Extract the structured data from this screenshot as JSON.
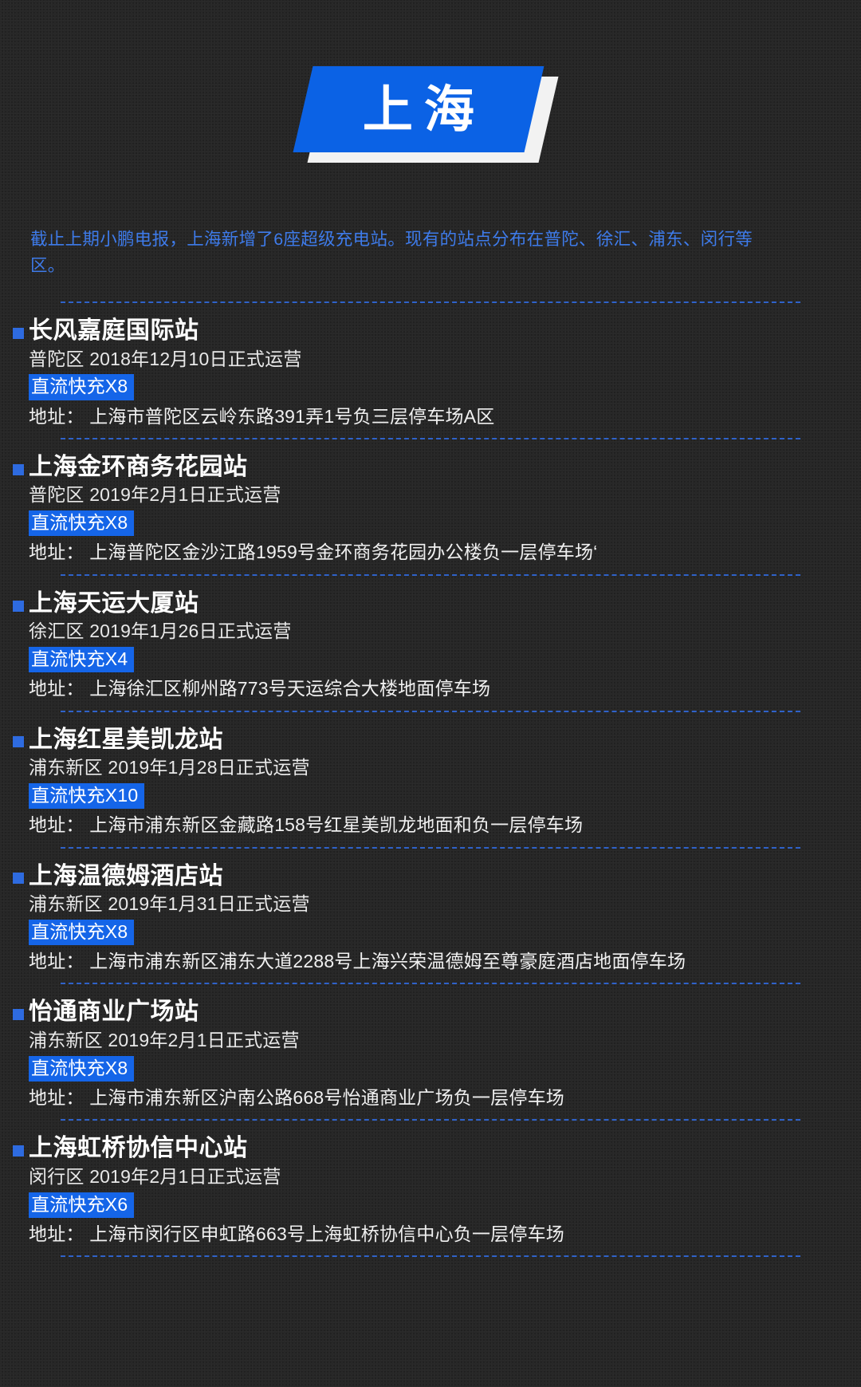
{
  "banner": {
    "title": "上海",
    "accent_color": "#0B62E5",
    "shadow_color": "#f2f2f2"
  },
  "intro": {
    "text": "截止上期小鹏电报，上海新增了6座超级充电站。现有的站点分布在普陀、徐汇、浦东、闵行等区。",
    "color": "#3E7BEA"
  },
  "labels": {
    "address_prefix": "地址：",
    "bullet_icon": "square-bullet-icon",
    "separator_icon": "dashed-separator"
  },
  "stations": [
    {
      "name": "长风嘉庭国际站",
      "meta": "普陀区  2018年12月10日正式运营",
      "badge": "直流快充X8",
      "address": "地址： 上海市普陀区云岭东路391弄1号负三层停车场A区"
    },
    {
      "name": "上海金环商务花园站",
      "meta": "普陀区  2019年2月1日正式运营",
      "badge": "直流快充X8",
      "address": "地址： 上海普陀区金沙江路1959号金环商务花园办公楼负一层停车场‘"
    },
    {
      "name": "上海天运大厦站",
      "meta": "徐汇区  2019年1月26日正式运营",
      "badge": "直流快充X4",
      "address": "地址： 上海徐汇区柳州路773号天运综合大楼地面停车场"
    },
    {
      "name": "上海红星美凯龙站",
      "meta": "浦东新区  2019年1月28日正式运营",
      "badge": "直流快充X10",
      "address": "地址： 上海市浦东新区金藏路158号红星美凯龙地面和负一层停车场"
    },
    {
      "name": "上海温德姆酒店站",
      "meta": "浦东新区  2019年1月31日正式运营",
      "badge": "直流快充X8",
      "address": "地址： 上海市浦东新区浦东大道2288号上海兴荣温德姆至尊豪庭酒店地面停车场"
    },
    {
      "name": "怡通商业广场站",
      "meta": "浦东新区  2019年2月1日正式运营",
      "badge": "直流快充X8",
      "address": "地址： 上海市浦东新区沪南公路668号怡通商业广场负一层停车场"
    },
    {
      "name": "上海虹桥协信中心站",
      "meta": "闵行区  2019年2月1日正式运营",
      "badge": "直流快充X6",
      "address": "地址： 上海市闵行区申虹路663号上海虹桥协信中心负一层停车场"
    }
  ]
}
